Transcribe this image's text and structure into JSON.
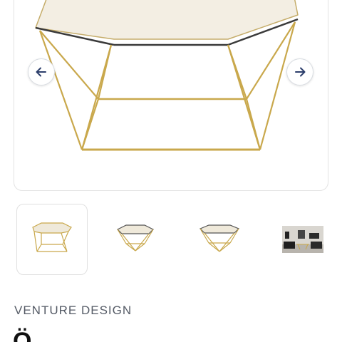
{
  "gallery": {
    "main_image": {
      "alt": "Octagonal glass coffee table with gold frame"
    },
    "prev_icon": "arrow-left-icon",
    "next_icon": "arrow-right-icon",
    "accent_color": "#2c3e6b",
    "frame_color": "#c9a84c",
    "thumbnails": [
      {
        "name": "thumbnail-1",
        "active": true
      },
      {
        "name": "thumbnail-2",
        "active": false
      },
      {
        "name": "thumbnail-3",
        "active": false
      },
      {
        "name": "thumbnail-4",
        "active": false
      }
    ]
  },
  "product": {
    "brand": "VENTURE DESIGN",
    "title": "Ö"
  }
}
